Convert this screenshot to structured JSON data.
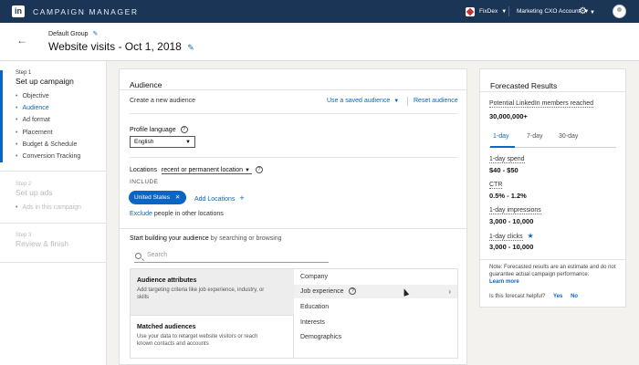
{
  "topbar": {
    "logo": "in",
    "product": "CAMPAIGN MANAGER",
    "account_name": "FixDex",
    "account_type": "Marketing CXO Account"
  },
  "header": {
    "back_icon": "arrow-left-icon",
    "group_name": "Default Group",
    "campaign_title": "Website visits - Oct 1, 2018"
  },
  "steps": [
    {
      "number": "Step 1",
      "title": "Set up campaign",
      "items": [
        "Objective",
        "Audience",
        "Ad format",
        "Placement",
        "Budget & Schedule",
        "Conversion Tracking"
      ]
    },
    {
      "number": "Step 2",
      "title": "Set up ads",
      "items": [
        "Ads in this campaign"
      ]
    },
    {
      "number": "Step 3",
      "title": "Review & finish",
      "items": []
    }
  ],
  "audience": {
    "heading": "Audience",
    "create_label": "Create a new audience",
    "use_saved": "Use a saved audience",
    "reset": "Reset audience",
    "profile_language_label": "Profile language",
    "profile_language_value": "English",
    "locations_label": "Locations",
    "locations_mode": "recent or permanent location",
    "include_label": "INCLUDE",
    "location_chip": "United States",
    "add_locations": "Add Locations",
    "exclude_link": "Exclude",
    "exclude_text": " people in other locations",
    "build_bold": "Start building your audience",
    "build_rest": " by searching or browsing",
    "search_placeholder": "Search",
    "attributes_title": "Audience attributes",
    "attributes_desc": "Add targeting criteria like job experience, industry, or skills",
    "matched_title": "Matched audiences",
    "matched_desc": "Use your data to retarget website visitors or reach known contacts and accounts",
    "categories": [
      "Company",
      "Job experience",
      "Education",
      "Interests",
      "Demographics"
    ]
  },
  "forecast": {
    "title": "Forecasted Results",
    "members_label": "Potential LinkedIn members reached",
    "members_value": "30,000,000+",
    "tabs": [
      "1-day",
      "7-day",
      "30-day"
    ],
    "spend_label": "1-day spend",
    "spend_value": "$40 - $50",
    "ctr_label": "CTR",
    "ctr_value": "0.5% - 1.2%",
    "impressions_label": "1-day impressions",
    "impressions_value": "3,000 - 10,000",
    "clicks_label": "1-day clicks",
    "clicks_value": "3,000 - 10,000",
    "note": "Note: Forecasted results are an estimate and do not guarantee actual campaign performance.",
    "learn_more": "Learn more",
    "helpful_q": "Is this forecast helpful?",
    "yes": "Yes",
    "no": "No"
  }
}
